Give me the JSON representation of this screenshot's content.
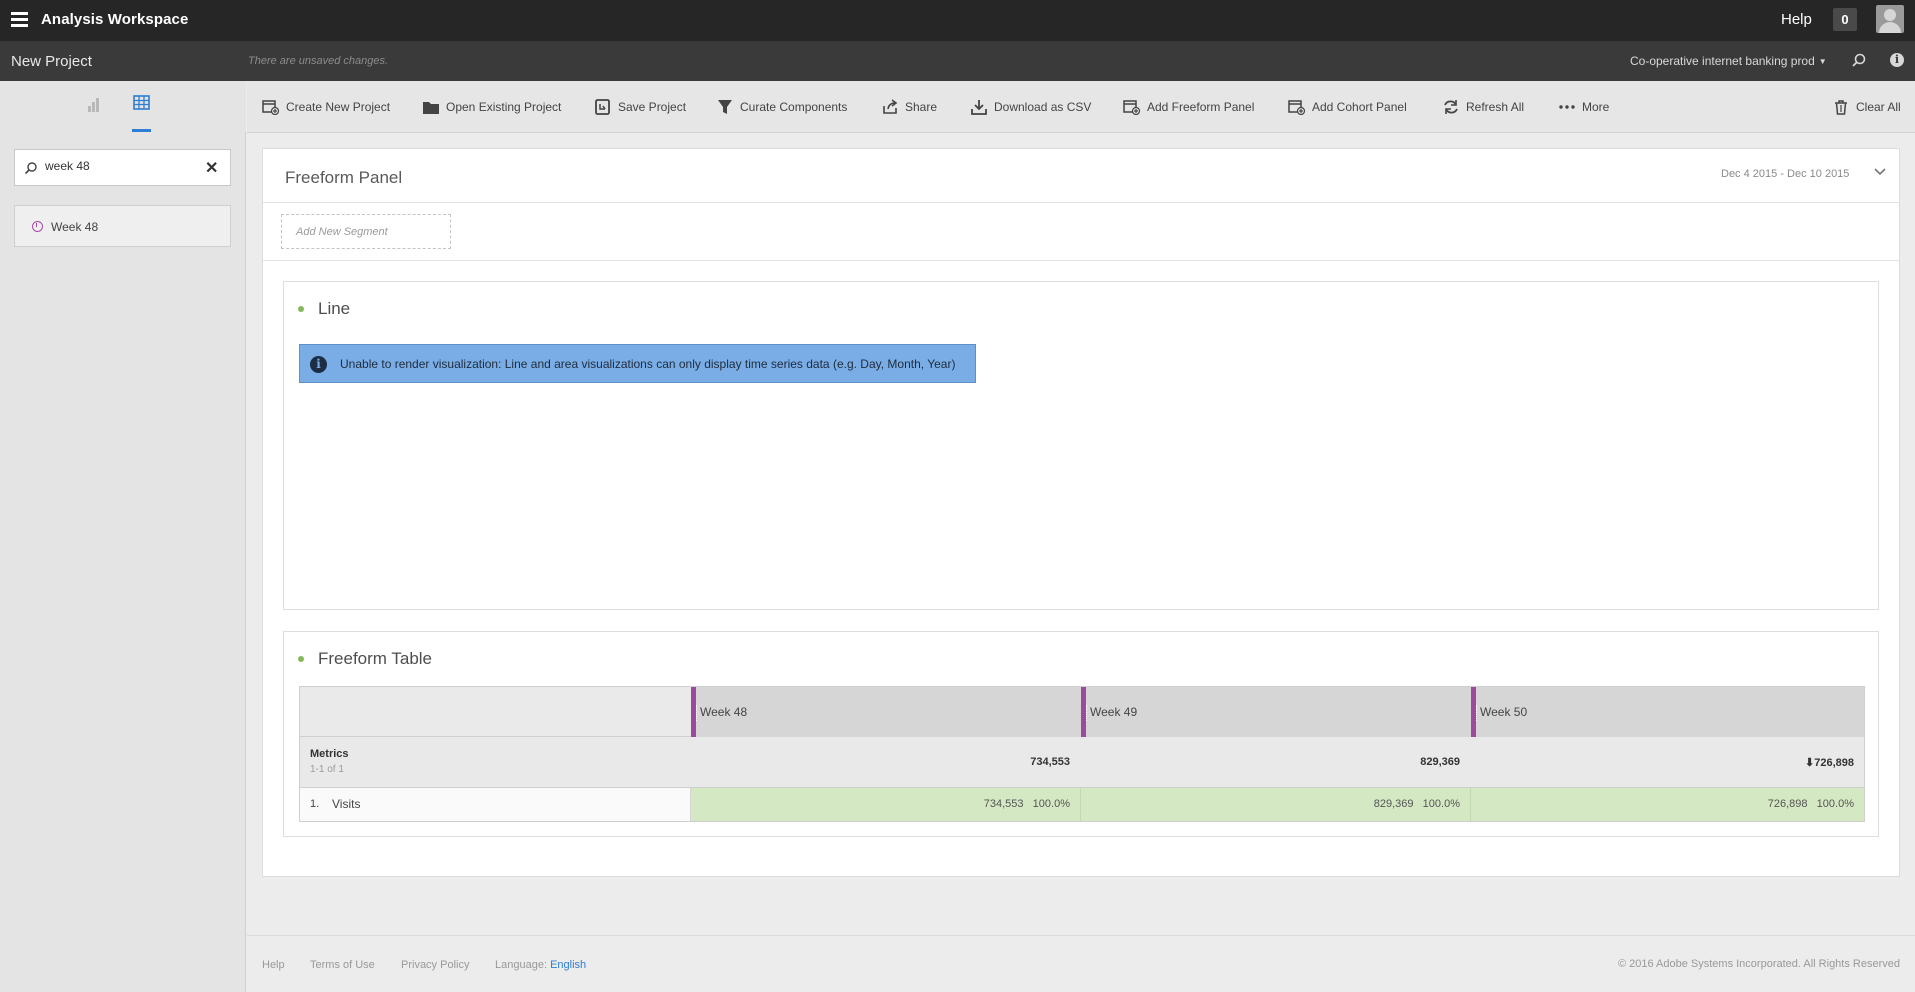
{
  "header": {
    "app_title": "Analysis Workspace",
    "help": "Help",
    "notification_count": "0"
  },
  "project_bar": {
    "project_name": "New Project",
    "unsaved_text": "There are unsaved changes.",
    "report_suite": "Co-operative internet banking prod"
  },
  "left_panel": {
    "search_value": "week 48",
    "results": [
      {
        "label": "Week 48",
        "icon": "clock-icon"
      }
    ]
  },
  "toolbar": {
    "create_new_project": "Create New Project",
    "open_existing_project": "Open Existing Project",
    "save_project": "Save Project",
    "curate_components": "Curate Components",
    "share": "Share",
    "download_csv": "Download as CSV",
    "add_freeform_panel": "Add Freeform Panel",
    "add_cohort_panel": "Add Cohort Panel",
    "refresh_all": "Refresh All",
    "more": "More",
    "clear_all": "Clear All"
  },
  "panel": {
    "title": "Freeform Panel",
    "date_range": "Dec 4 2015 - Dec 10 2015",
    "segment_placeholder": "Add New Segment"
  },
  "line_viz": {
    "title": "Line",
    "notice": "Unable to render visualization: Line and area visualizations can only display time series data (e.g. Day, Month, Year)"
  },
  "table_viz": {
    "title": "Freeform Table",
    "columns": [
      "Week 48",
      "Week 49",
      "Week 50"
    ],
    "metrics_label": "Metrics",
    "metrics_sub": "1-1 of 1",
    "totals": [
      "734,553",
      "829,369",
      "726,898"
    ],
    "rows": [
      {
        "index": "1.",
        "name": "Visits",
        "cells": [
          "734,553   100.0%",
          "829,369   100.0%",
          "726,898   100.0%"
        ]
      }
    ]
  },
  "footer": {
    "help": "Help",
    "terms": "Terms of Use",
    "privacy": "Privacy Policy",
    "language_label": "Language:",
    "language_value": "English",
    "copyright": "© 2016 Adobe Systems Incorporated. All Rights Reserved"
  },
  "colors": {
    "accent_blue": "#2d7ed4",
    "segment_purple": "#9c4a9c",
    "cell_green": "#d5e8c4",
    "notice_blue": "#7aade5"
  }
}
